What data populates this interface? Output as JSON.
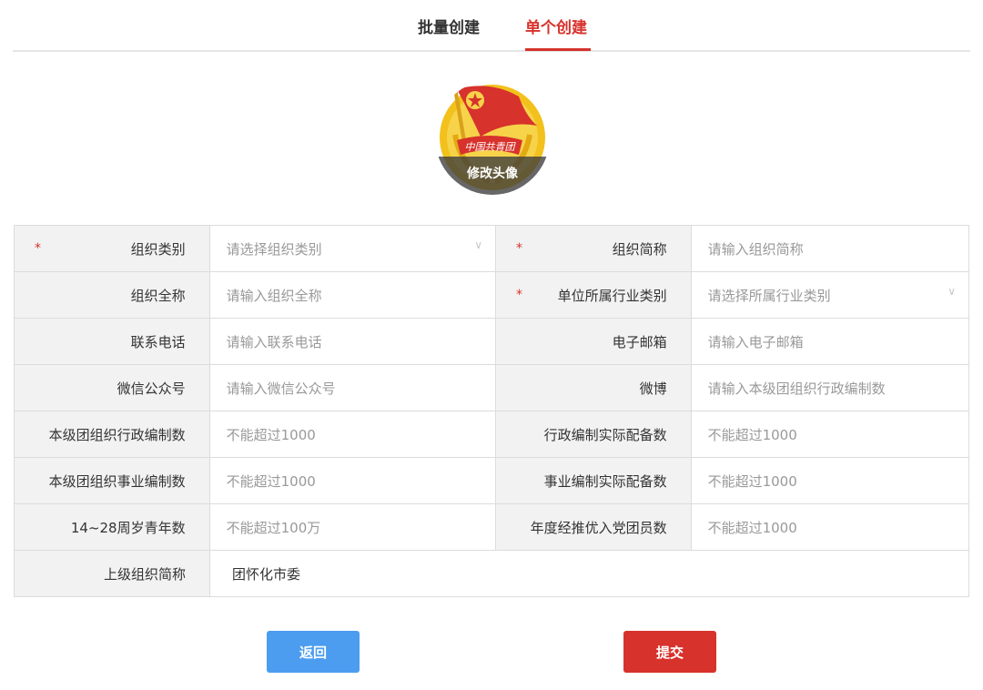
{
  "tabs": {
    "batch": "批量创建",
    "single": "单个创建"
  },
  "avatar": {
    "badge_text": "中国共青团",
    "change_label": "修改头像"
  },
  "form": {
    "required_mark": "*",
    "rows": [
      {
        "l1": "组织类别",
        "v1": "请选择组织类别",
        "l2": "组织简称",
        "v2": "请输入组织简称"
      },
      {
        "l1": "组织全称",
        "v1": "请输入组织全称",
        "l2": "单位所属行业类别",
        "v2": "请选择所属行业类别"
      },
      {
        "l1": "联系电话",
        "v1": "请输入联系电话",
        "l2": "电子邮箱",
        "v2": "请输入电子邮箱"
      },
      {
        "l1": "微信公众号",
        "v1": "请输入微信公众号",
        "l2": "微博",
        "v2": "请输入本级团组织行政编制数"
      },
      {
        "l1": "本级团组织行政编制数",
        "v1": "不能超过1000",
        "l2": "行政编制实际配备数",
        "v2": "不能超过1000"
      },
      {
        "l1": "本级团组织事业编制数",
        "v1": "不能超过1000",
        "l2": "事业编制实际配备数",
        "v2": "不能超过1000"
      },
      {
        "l1": "14~28周岁青年数",
        "v1": "不能超过100万",
        "l2": "年度经推优入党团员数",
        "v2": "不能超过1000"
      }
    ],
    "parent_label": "上级组织简称",
    "parent_value": "团怀化市委"
  },
  "buttons": {
    "back": "返回",
    "submit": "提交"
  },
  "colors": {
    "accent_red": "#d7322c",
    "back_blue": "#4c9df0",
    "label_bg": "#f2f2f2"
  }
}
